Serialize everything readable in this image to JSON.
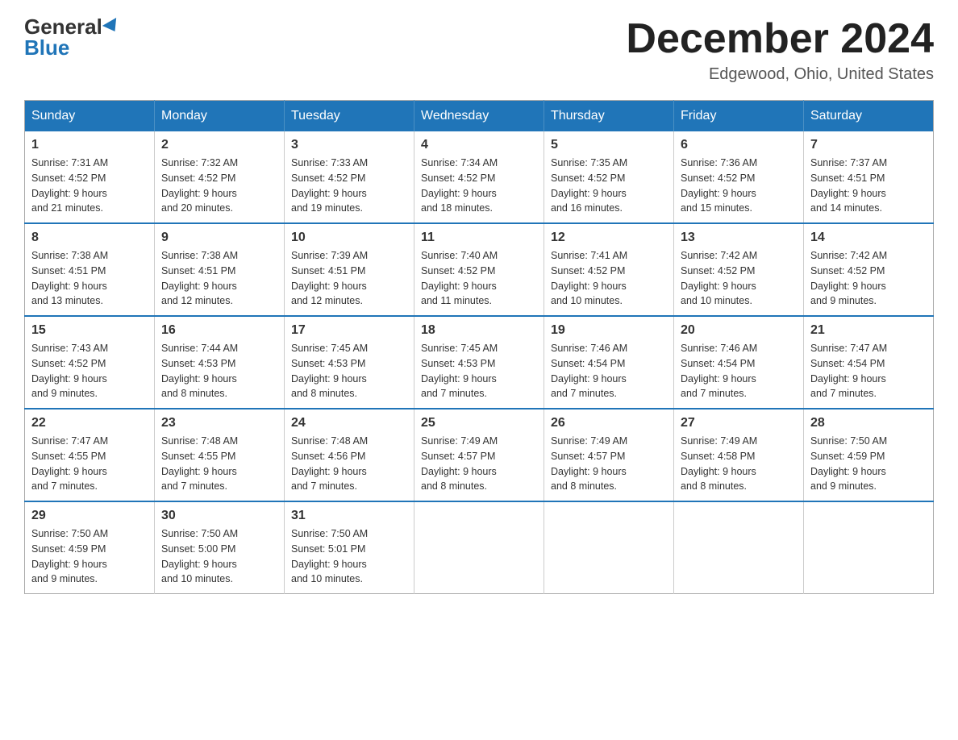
{
  "header": {
    "logo_general": "General",
    "logo_blue": "Blue",
    "month_title": "December 2024",
    "location": "Edgewood, Ohio, United States"
  },
  "days_of_week": [
    "Sunday",
    "Monday",
    "Tuesday",
    "Wednesday",
    "Thursday",
    "Friday",
    "Saturday"
  ],
  "weeks": [
    [
      {
        "day": "1",
        "sunrise": "7:31 AM",
        "sunset": "4:52 PM",
        "daylight": "9 hours and 21 minutes."
      },
      {
        "day": "2",
        "sunrise": "7:32 AM",
        "sunset": "4:52 PM",
        "daylight": "9 hours and 20 minutes."
      },
      {
        "day": "3",
        "sunrise": "7:33 AM",
        "sunset": "4:52 PM",
        "daylight": "9 hours and 19 minutes."
      },
      {
        "day": "4",
        "sunrise": "7:34 AM",
        "sunset": "4:52 PM",
        "daylight": "9 hours and 18 minutes."
      },
      {
        "day": "5",
        "sunrise": "7:35 AM",
        "sunset": "4:52 PM",
        "daylight": "9 hours and 16 minutes."
      },
      {
        "day": "6",
        "sunrise": "7:36 AM",
        "sunset": "4:52 PM",
        "daylight": "9 hours and 15 minutes."
      },
      {
        "day": "7",
        "sunrise": "7:37 AM",
        "sunset": "4:51 PM",
        "daylight": "9 hours and 14 minutes."
      }
    ],
    [
      {
        "day": "8",
        "sunrise": "7:38 AM",
        "sunset": "4:51 PM",
        "daylight": "9 hours and 13 minutes."
      },
      {
        "day": "9",
        "sunrise": "7:38 AM",
        "sunset": "4:51 PM",
        "daylight": "9 hours and 12 minutes."
      },
      {
        "day": "10",
        "sunrise": "7:39 AM",
        "sunset": "4:51 PM",
        "daylight": "9 hours and 12 minutes."
      },
      {
        "day": "11",
        "sunrise": "7:40 AM",
        "sunset": "4:52 PM",
        "daylight": "9 hours and 11 minutes."
      },
      {
        "day": "12",
        "sunrise": "7:41 AM",
        "sunset": "4:52 PM",
        "daylight": "9 hours and 10 minutes."
      },
      {
        "day": "13",
        "sunrise": "7:42 AM",
        "sunset": "4:52 PM",
        "daylight": "9 hours and 10 minutes."
      },
      {
        "day": "14",
        "sunrise": "7:42 AM",
        "sunset": "4:52 PM",
        "daylight": "9 hours and 9 minutes."
      }
    ],
    [
      {
        "day": "15",
        "sunrise": "7:43 AM",
        "sunset": "4:52 PM",
        "daylight": "9 hours and 9 minutes."
      },
      {
        "day": "16",
        "sunrise": "7:44 AM",
        "sunset": "4:53 PM",
        "daylight": "9 hours and 8 minutes."
      },
      {
        "day": "17",
        "sunrise": "7:45 AM",
        "sunset": "4:53 PM",
        "daylight": "9 hours and 8 minutes."
      },
      {
        "day": "18",
        "sunrise": "7:45 AM",
        "sunset": "4:53 PM",
        "daylight": "9 hours and 7 minutes."
      },
      {
        "day": "19",
        "sunrise": "7:46 AM",
        "sunset": "4:54 PM",
        "daylight": "9 hours and 7 minutes."
      },
      {
        "day": "20",
        "sunrise": "7:46 AM",
        "sunset": "4:54 PM",
        "daylight": "9 hours and 7 minutes."
      },
      {
        "day": "21",
        "sunrise": "7:47 AM",
        "sunset": "4:54 PM",
        "daylight": "9 hours and 7 minutes."
      }
    ],
    [
      {
        "day": "22",
        "sunrise": "7:47 AM",
        "sunset": "4:55 PM",
        "daylight": "9 hours and 7 minutes."
      },
      {
        "day": "23",
        "sunrise": "7:48 AM",
        "sunset": "4:55 PM",
        "daylight": "9 hours and 7 minutes."
      },
      {
        "day": "24",
        "sunrise": "7:48 AM",
        "sunset": "4:56 PM",
        "daylight": "9 hours and 7 minutes."
      },
      {
        "day": "25",
        "sunrise": "7:49 AM",
        "sunset": "4:57 PM",
        "daylight": "9 hours and 8 minutes."
      },
      {
        "day": "26",
        "sunrise": "7:49 AM",
        "sunset": "4:57 PM",
        "daylight": "9 hours and 8 minutes."
      },
      {
        "day": "27",
        "sunrise": "7:49 AM",
        "sunset": "4:58 PM",
        "daylight": "9 hours and 8 minutes."
      },
      {
        "day": "28",
        "sunrise": "7:50 AM",
        "sunset": "4:59 PM",
        "daylight": "9 hours and 9 minutes."
      }
    ],
    [
      {
        "day": "29",
        "sunrise": "7:50 AM",
        "sunset": "4:59 PM",
        "daylight": "9 hours and 9 minutes."
      },
      {
        "day": "30",
        "sunrise": "7:50 AM",
        "sunset": "5:00 PM",
        "daylight": "9 hours and 10 minutes."
      },
      {
        "day": "31",
        "sunrise": "7:50 AM",
        "sunset": "5:01 PM",
        "daylight": "9 hours and 10 minutes."
      },
      null,
      null,
      null,
      null
    ]
  ],
  "labels": {
    "sunrise_prefix": "Sunrise: ",
    "sunset_prefix": "Sunset: ",
    "daylight_prefix": "Daylight: "
  }
}
